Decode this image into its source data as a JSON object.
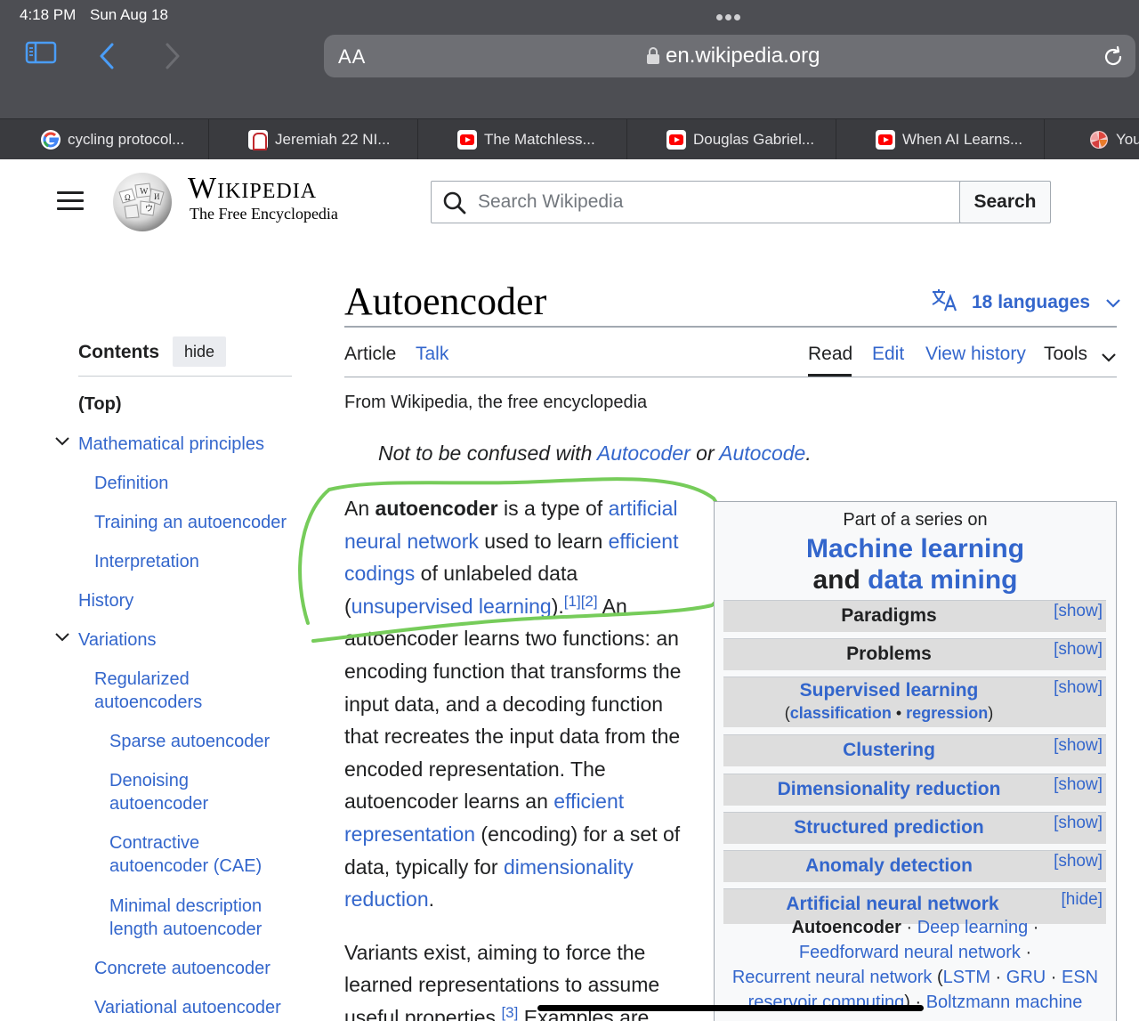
{
  "status_bar": {
    "time": "4:18 PM",
    "date": "Sun Aug 18"
  },
  "browser": {
    "aa_label": "AA",
    "url": "en.wikipedia.org",
    "tabs": [
      {
        "title": "cycling protocol...",
        "favicon": "google-icon"
      },
      {
        "title": "Jeremiah 22 NI...",
        "favicon": "bible-app-icon"
      },
      {
        "title": "The Matchless...",
        "favicon": "youtube-icon"
      },
      {
        "title": "Douglas Gabriel...",
        "favicon": "youtube-icon"
      },
      {
        "title": "When AI Learns...",
        "favicon": "youtube-icon"
      },
      {
        "title": "You",
        "favicon": "pinwheel-icon"
      }
    ]
  },
  "wiki_header": {
    "wordmark": "Wikipedia",
    "tagline": "The Free Encyclopedia",
    "search_placeholder": "Search Wikipedia",
    "search_button": "Search"
  },
  "toc": {
    "title": "Contents",
    "hide_label": "hide",
    "items": [
      {
        "label": "(Top)"
      },
      {
        "label": "Mathematical principles"
      },
      {
        "label": "Definition"
      },
      {
        "label": "Training an autoencoder"
      },
      {
        "label": "Interpretation"
      },
      {
        "label": "History"
      },
      {
        "label": "Variations"
      },
      {
        "label": "Regularized autoencoders"
      },
      {
        "label": "Sparse autoencoder"
      },
      {
        "label": "Denoising autoencoder"
      },
      {
        "label": "Contractive autoencoder (CAE)"
      },
      {
        "label": "Minimal description length autoencoder"
      },
      {
        "label": "Concrete autoencoder"
      },
      {
        "label": "Variational autoencoder"
      }
    ]
  },
  "article": {
    "title": "Autoencoder",
    "languages": "18 languages",
    "tabs": {
      "article": "Article",
      "talk": "Talk",
      "read": "Read",
      "edit": "Edit",
      "history": "View history",
      "tools": "Tools"
    },
    "from": "From Wikipedia, the free encyclopedia",
    "hatnote": {
      "prefix": "Not to be confused with ",
      "link1": "Autocoder",
      "middle": " or ",
      "link2": "Autocode",
      "suffix": "."
    },
    "p1": {
      "t1": "An ",
      "b1": "autoencoder",
      "t2": " is a type of ",
      "l1": "artificial neural network",
      "t3": " used to learn ",
      "l2": "efficient codings",
      "t4": " of unlabeled data (",
      "l3": "unsupervised learning",
      "t5": ").",
      "ref1": "[1]",
      "ref2": "[2]",
      "t6": " An autoencoder learns two functions: an encoding function that transforms the input data, and a decoding function that recreates the input data from the encoded representation. The autoencoder learns an ",
      "l4": "efficient representation",
      "t7": " (encoding) for a set of data, typically for ",
      "l5": "dimensionality reduction",
      "t8": "."
    },
    "p2": {
      "t1": "Variants exist, aiming to force the learned representations to assume useful properties.",
      "ref": "[3]",
      "t2": " Examples are"
    }
  },
  "infobox": {
    "series": "Part of a series on",
    "title_line1": "Machine learning",
    "title_and": "and ",
    "title_link2": "data mining",
    "rows": [
      {
        "label": "Paradigms",
        "toggle": "[show]"
      },
      {
        "label": "Problems",
        "toggle": "[show]"
      },
      {
        "label": "Supervised learning",
        "toggle": "[show]"
      },
      {
        "label": "Clustering",
        "toggle": "[show]"
      },
      {
        "label": "Dimensionality reduction",
        "toggle": "[show]"
      },
      {
        "label": "Structured prediction",
        "toggle": "[show]"
      },
      {
        "label": "Anomaly detection",
        "toggle": "[show]"
      },
      {
        "label": "Artificial neural network",
        "toggle": "[hide]"
      }
    ],
    "supervised_sub": {
      "open": "(",
      "a": "classification",
      "sep": " • ",
      "b": "regression",
      "close": ")"
    },
    "ann_items": {
      "current": "Autoencoder",
      "i1": "Deep learning",
      "i2": "Feedforward neural network",
      "i3": "Recurrent neural network",
      "i4": "LSTM",
      "i5": "GRU",
      "i6": "ESN",
      "i7": "reservoir computing",
      "i8": "Boltzmann machine"
    }
  }
}
